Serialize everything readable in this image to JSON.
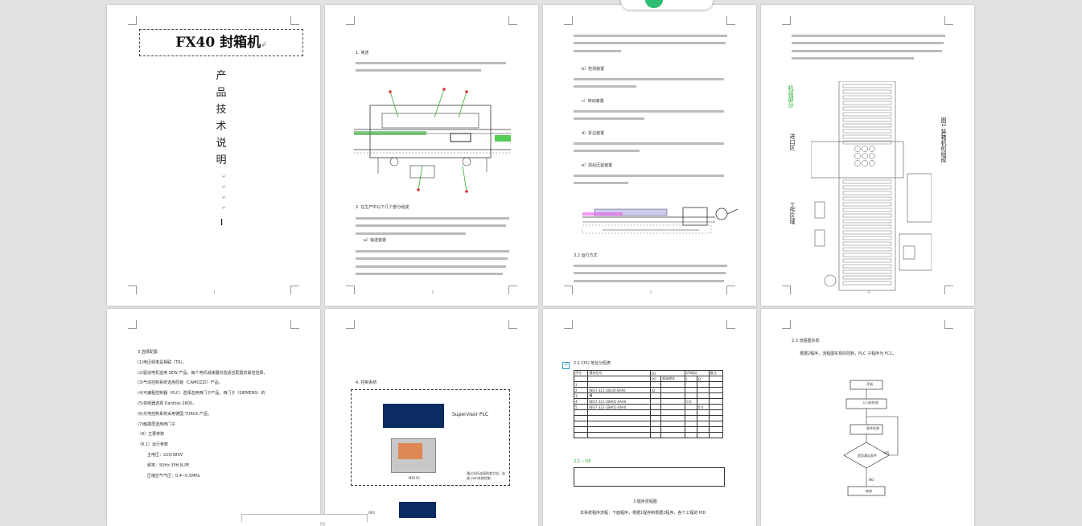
{
  "page1": {
    "title": "FX40 封箱机",
    "title_mark": "↲",
    "vertical_chars": [
      "产",
      "品",
      "技",
      "术",
      "说",
      "明"
    ],
    "cursor": "I"
  },
  "page2": {
    "heading1": "1. 简述",
    "section2": "2. 在生产中以下几个部分组成",
    "subsection_a": "a）输送装置"
  },
  "page3": {
    "section_b": "b）检测装置",
    "section_c": "c）转动装置",
    "section_d": "d）折边装置",
    "section_e": "e）前后压紧装置",
    "section32": "3.2 运行方式"
  },
  "page4": {
    "label_left_top": "机组部分",
    "label_left_mid": "进口区",
    "label_left_bottom": "工作区域",
    "label_right": "图1 装箱机的组成"
  },
  "page5": {
    "items": [
      "3 选择配置：",
      "(1)电压频率是相联（TR）。",
      "(2)驱动电机选用 SEW 产品，每个电机减速器均选适应配置的最佳选择，",
      "(3)气动控制系统选用原装（CAMOZZI）产品，",
      "(4)可编程控制器（PLC）选择选用西门子产品，西门子（SIEMENS）的",
      "(5)变频器选择 Danfoss 2800，",
      "(6)光电控制系统采用德国 TURCK 产品，",
      "(7)触摸屏选用西门子",
      "（8）主要参数",
      "（8.1）运行参数",
      "主电压：220/380V",
      "频率：50Hz 3PH,N,PE",
      "压缩空气气压：0.4~0.5MPa"
    ]
  },
  "page6": {
    "section": "4. 控制系统",
    "supervisor": "Supervisor PLC",
    "hmi_label": "MP270",
    "note": "通过光纤连接到其它站，连接.com系统控制",
    "tag": "OP2"
  },
  "page7": {
    "section": "2.1 CPU 地址分配表",
    "table_headers": [
      "序号",
      "模块型号",
      "I/O",
      "I/O地址",
      "备注"
    ],
    "table_sub": [
      "I/O",
      "起始地址",
      "I",
      "Q"
    ],
    "rows": [
      [
        "1",
        "",
        "",
        "",
        "",
        "",
        ""
      ],
      [
        "2",
        "6ES7 321-1BL00-0AA0",
        "32",
        "",
        "",
        "",
        ""
      ],
      [
        "3",
        "槽",
        "",
        "",
        "",
        "",
        ""
      ],
      [
        "4",
        "6ES7 321-1BH02-0AA0",
        "",
        "",
        "0.0",
        "",
        ""
      ],
      [
        "5",
        "6ES7 322-1BH01-0AA0",
        "",
        "",
        "",
        "0.0",
        ""
      ]
    ],
    "section2": "2.2 -- DP",
    "footer": "3 程序流程图",
    "footer_text": "本系统程序流程：下面程序，根据1程序和根据2程序，各个工程的 PID"
  },
  "page8": {
    "section": "2.3 流程图实现",
    "subtitle": "根据2程序，流程图实现的控制，PLC 子程序为 FC1。",
    "flow": [
      "开始",
      "入口处检测",
      "条件检测",
      "是否满足条件",
      "结束"
    ],
    "yes": "YES",
    "no": "NO"
  }
}
